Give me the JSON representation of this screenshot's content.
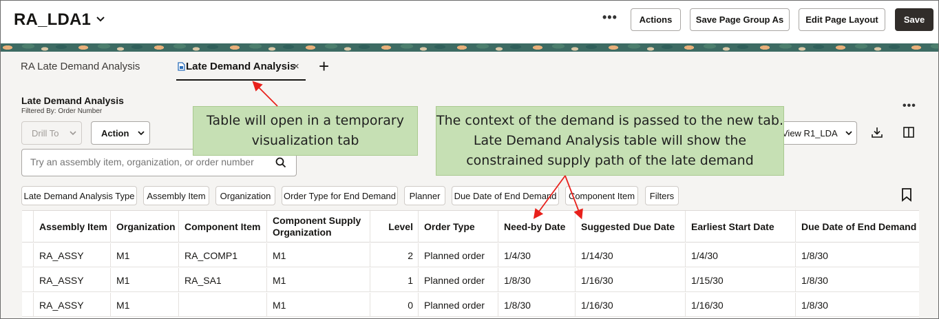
{
  "header": {
    "title": "RA_LDA1",
    "more_label": "•••",
    "actions_label": "Actions",
    "save_group_label": "Save Page Group As",
    "edit_layout_label": "Edit Page Layout",
    "save_label": "Save"
  },
  "tabs": [
    {
      "label": "RA Late Demand Analysis",
      "active": false
    },
    {
      "label": "Late Demand Analysis",
      "active": true,
      "close": "×"
    }
  ],
  "tab_add": "+",
  "section": {
    "title": "Late Demand Analysis",
    "subtitle": "Filtered By: Order Number",
    "more_label": "•••"
  },
  "toolbar": {
    "drill_label": "Drill To",
    "action_label": "Action",
    "view_label": "View R1_LDA"
  },
  "search": {
    "placeholder": "Try an assembly item, organization, or order number"
  },
  "filters": [
    "Late Demand Analysis Type",
    "Assembly Item",
    "Organization",
    "Order Type for End Demand",
    "Planner",
    "Due Date of End Demand",
    "Component Item",
    "Filters"
  ],
  "table": {
    "columns": [
      "Assembly Item",
      "Organization",
      "Component Item",
      "Component Supply Organization",
      "Level",
      "Order Type",
      "Need-by Date",
      "Suggested Due Date",
      "Earliest Start Date",
      "Due Date of End Demand"
    ],
    "rows": [
      [
        "RA_ASSY",
        "M1",
        "RA_COMP1",
        "M1",
        "2",
        "Planned order",
        "1/4/30",
        "1/14/30",
        "1/4/30",
        "1/8/30"
      ],
      [
        "RA_ASSY",
        "M1",
        "RA_SA1",
        "M1",
        "1",
        "Planned order",
        "1/8/30",
        "1/16/30",
        "1/15/30",
        "1/8/30"
      ],
      [
        "RA_ASSY",
        "M1",
        "",
        "M1",
        "0",
        "Planned order",
        "1/8/30",
        "1/16/30",
        "1/16/30",
        "1/8/30"
      ]
    ]
  },
  "callouts": {
    "temp_tab": "Table will open in a temporary visualization tab",
    "context": "The context of the demand is passed to the new tab. Late Demand Analysis table will show the constrained supply path of the late demand"
  },
  "colors": {
    "save_button": "#312d2a",
    "callout_fill": "#c6e0b4",
    "arrow": "#e8201b"
  }
}
